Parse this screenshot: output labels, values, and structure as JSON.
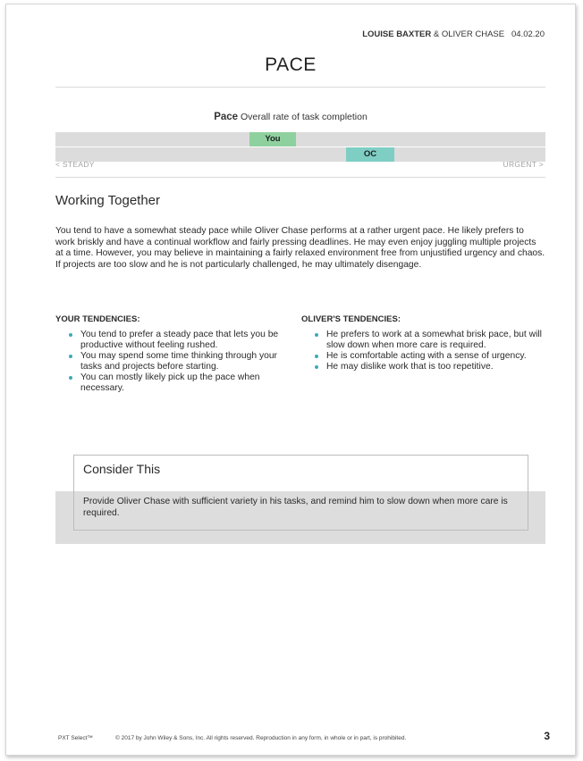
{
  "header": {
    "name1": "LOUISE BAXTER",
    "amp": "&",
    "name2": "OLIVER CHASE",
    "date": "04.02.20"
  },
  "title": "PACE",
  "scale": {
    "name": "Pace",
    "description": "Overall rate of task completion",
    "you_label": "You",
    "oc_label": "OC",
    "left_label": "< STEADY",
    "right_label": "URGENT >"
  },
  "working_together": {
    "heading": "Working Together",
    "text": "You tend to have a somewhat steady pace while Oliver Chase performs at a rather urgent pace. He likely prefers to work briskly and have a continual workflow and fairly pressing deadlines. He may even enjoy juggling multiple projects at a time. However, you may believe in maintaining a fairly relaxed environment free from unjustified urgency and chaos. If projects are too slow and he is not particularly challenged, he may ultimately disengage."
  },
  "your_tendencies": {
    "title": "YOUR TENDENCIES:",
    "items": [
      "You tend to prefer a steady pace that lets you be productive without feeling rushed.",
      "You may spend some time thinking through your tasks and projects before starting.",
      "You can mostly likely pick up the pace when necessary."
    ]
  },
  "olivers_tendencies": {
    "title": "OLIVER'S TENDENCIES:",
    "items": [
      "He prefers to work at a somewhat brisk pace, but will slow down when more care is required.",
      "He is comfortable acting with a sense of urgency.",
      "He may dislike work that is too repetitive."
    ]
  },
  "consider": {
    "title": "Consider This",
    "text": "Provide Oliver Chase with sufficient variety in his tasks, and remind him to slow down when more care is required."
  },
  "footer": {
    "brand": "PXT Select™",
    "copyright": "© 2017 by John Wiley & Sons, Inc. All rights reserved. Reproduction in any form, in whole or in part, is prohibited.",
    "page_number": "3"
  }
}
